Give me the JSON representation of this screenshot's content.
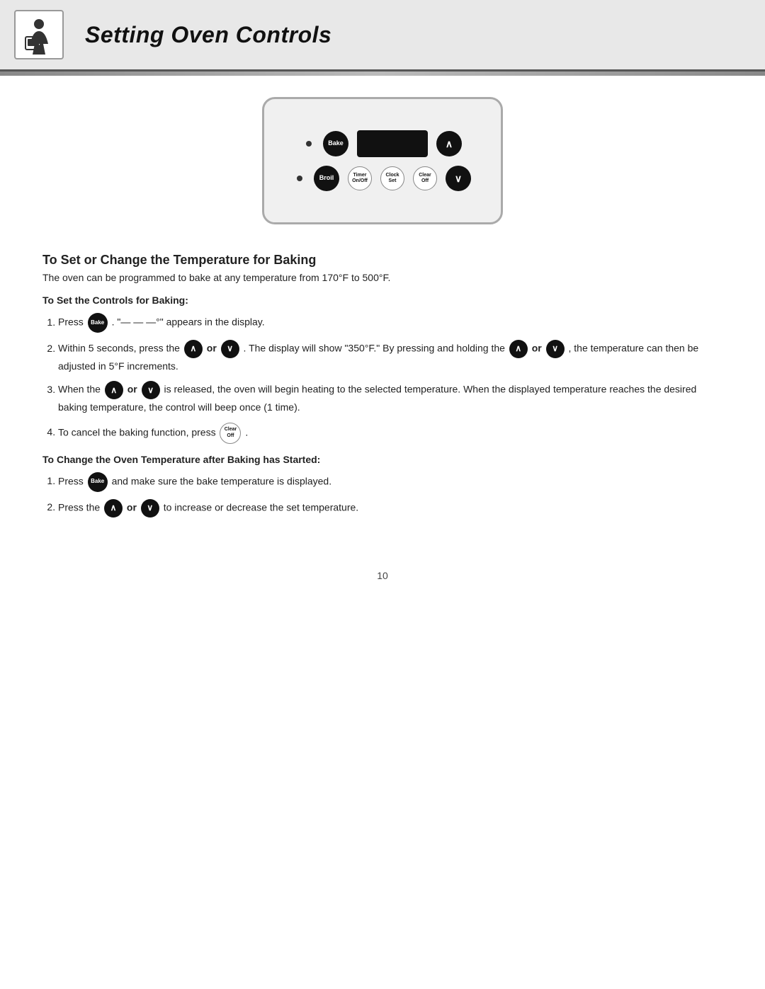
{
  "header": {
    "title": "Setting Oven Controls"
  },
  "panel": {
    "buttons": {
      "bake": "Bake",
      "broil": "Broil",
      "timer": "Timer\nOn/Off",
      "clock": "Clock\nSet",
      "clear": "Clear\nOff",
      "up_arrow": "∧",
      "down_arrow": "∨"
    }
  },
  "content": {
    "main_title": "To Set or Change the Temperature for Baking",
    "main_subtitle": "The oven can be programmed to bake at any temperature from 170°F to 500°F.",
    "set_controls_title": "To Set the Controls for Baking:",
    "set_controls_steps": [
      {
        "text_before_btn": "Press",
        "btn": "Bake",
        "text_after": ". \"— — —°\" appears in the display."
      },
      {
        "text": "Within 5 seconds, press the",
        "btn_up": "∧",
        "or": "or",
        "btn_down": "∨",
        "text2": ". The display will show \"350°F.\" By pressing and holding the",
        "btn_up2": "∧",
        "or2": "or",
        "btn_down2": "∨",
        "text3": ", the temperature can then be adjusted in 5°F increments."
      },
      {
        "text": "When the",
        "btn_up": "∧",
        "or": "or",
        "btn_down": "∨",
        "text2": "is released, the oven will begin heating to the selected temperature. When the displayed temperature reaches the desired baking temperature, the control will beep once (1 time)."
      },
      {
        "text": "To cancel the baking function, press",
        "btn": "Clear\nOff",
        "text2": "."
      }
    ],
    "change_title": "To Change the Oven Temperature after Baking has Started:",
    "change_steps": [
      {
        "text_before_btn": "Press",
        "btn": "Bake",
        "text_after": "and make sure the bake temperature is displayed."
      },
      {
        "text": "Press the",
        "btn_up": "∧",
        "or": "or",
        "btn_down": "∨",
        "text2": "to increase or decrease the set temperature."
      }
    ]
  },
  "page_number": "10"
}
